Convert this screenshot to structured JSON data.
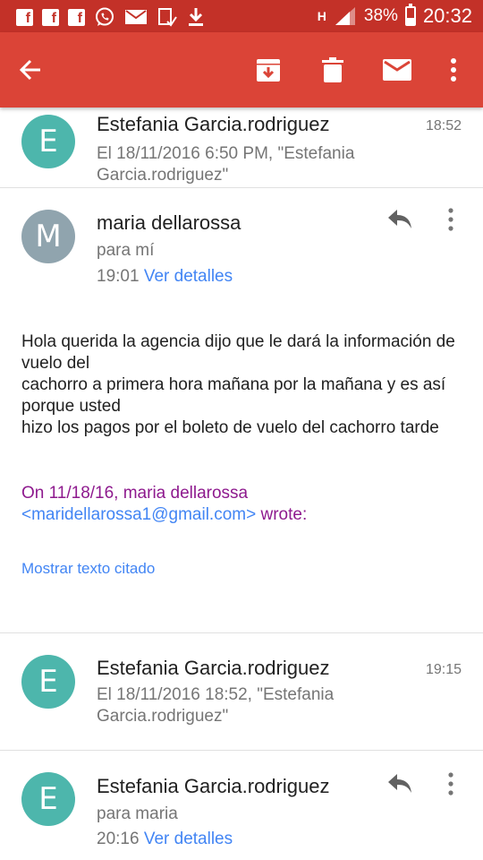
{
  "status_bar": {
    "left_icons": [
      "facebook-icon",
      "facebook-icon",
      "facebook-icon",
      "whatsapp-icon",
      "mail-icon",
      "device-icon",
      "download-icon"
    ],
    "network_label": "H",
    "battery_percent": "38%",
    "battery_level": 0.38,
    "time": "20:32"
  },
  "toolbar": {
    "back_icon": "arrow-left-icon",
    "archive_icon": "archive-icon",
    "delete_icon": "trash-icon",
    "mark_unread_icon": "mail-icon",
    "more_icon": "more-vertical-icon"
  },
  "messages": [
    {
      "avatar_letter": "E",
      "sender": "Estefania Garcia.rodriguez",
      "time": "18:52",
      "snippet": "El 18/11/2016 6:50 PM, \"Estefania Garcia.rodriguez\""
    },
    {
      "avatar_letter": "M",
      "sender": "maria dellarossa",
      "recipient": "para mí",
      "time": "19:01",
      "details_link": "Ver detalles",
      "body": [
        "Hola querida la agencia dijo que le dará la información de vuelo del",
        "cachorro a primera hora mañana por la mañana y es así porque usted",
        "hizo los pagos por el boleto de vuelo del cachorro tarde"
      ],
      "quote_header_prefix": "On 11/18/16, maria dellarossa",
      "quote_email_open": "<",
      "quote_email": "maridellarossa1@gmail.com",
      "quote_email_close": ">",
      "quote_wrote": " wrote:",
      "show_quoted": "Mostrar texto citado"
    },
    {
      "avatar_letter": "E",
      "sender": "Estefania Garcia.rodriguez",
      "time": "19:15",
      "snippet": "El 18/11/2016 18:52, \"Estefania Garcia.rodriguez\""
    },
    {
      "avatar_letter": "E",
      "sender": "Estefania Garcia.rodriguez",
      "recipient": "para maria",
      "time": "20:16",
      "details_link": "Ver detalles"
    }
  ],
  "colors": {
    "status_bar": "#c33128",
    "toolbar": "#db4437",
    "avatar_teal": "#4db6ac",
    "avatar_gray": "#90a4ae",
    "link": "#4285f4",
    "quote": "#8e1a8e"
  }
}
